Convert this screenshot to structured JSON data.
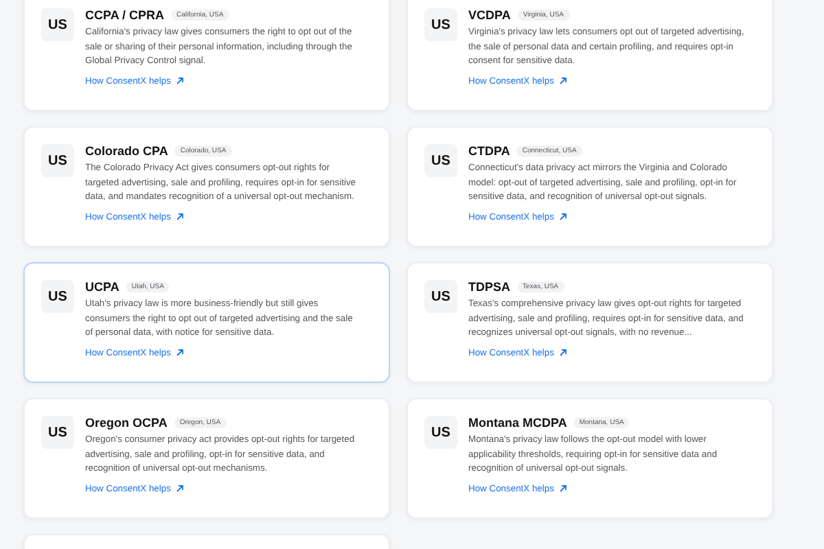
{
  "laws": [
    {
      "flag": "US",
      "name": "CCPA / CPRA",
      "region": "California, USA",
      "description": "California's privacy law gives consumers the right to opt out of the sale or sharing of their personal information, including through the Global Privacy Control signal.",
      "link": "How ConsentX helps",
      "highlighted": false
    },
    {
      "flag": "US",
      "name": "VCDPA",
      "region": "Virginia, USA",
      "description": "Virginia's privacy law lets consumers opt out of targeted advertising, the sale of personal data and certain profiling, and requires opt-in consent for sensitive data.",
      "link": "How ConsentX helps",
      "highlighted": false
    },
    {
      "flag": "US",
      "name": "Colorado CPA",
      "region": "Colorado, USA",
      "description": "The Colorado Privacy Act gives consumers opt-out rights for targeted advertising, sale and profiling, requires opt-in for sensitive data, and mandates recognition of a universal opt-out mechanism.",
      "link": "How ConsentX helps",
      "highlighted": false
    },
    {
      "flag": "US",
      "name": "CTDPA",
      "region": "Connecticut, USA",
      "description": "Connecticut's data privacy act mirrors the Virginia and Colorado model: opt-out of targeted advertising, sale and profiling, opt-in for sensitive data, and recognition of universal opt-out signals.",
      "link": "How ConsentX helps",
      "highlighted": false
    },
    {
      "flag": "US",
      "name": "UCPA",
      "region": "Utah, USA",
      "description": "Utah's privacy law is more business-friendly but still gives consumers the right to opt out of targeted advertising and the sale of personal data, with notice for sensitive data.",
      "link": "How ConsentX helps",
      "highlighted": true
    },
    {
      "flag": "US",
      "name": "TDPSA",
      "region": "Texas, USA",
      "description": "Texas's comprehensive privacy law gives opt-out rights for targeted advertising, sale and profiling, requires opt-in for sensitive data, and recognizes universal opt-out signals, with no revenue...",
      "link": "How ConsentX helps",
      "highlighted": false
    },
    {
      "flag": "US",
      "name": "Oregon OCPA",
      "region": "Oregon, USA",
      "description": "Oregon's consumer privacy act provides opt-out rights for targeted advertising, sale and profiling, opt-in for sensitive data, and recognition of universal opt-out mechanisms.",
      "link": "How ConsentX helps",
      "highlighted": false
    },
    {
      "flag": "US",
      "name": "Montana MCDPA",
      "region": "Montana, USA",
      "description": "Montana's privacy law follows the opt-out model with lower applicability thresholds, requiring opt-in for sensitive data and recognition of universal opt-out signals.",
      "link": "How ConsentX helps",
      "highlighted": false
    }
  ]
}
